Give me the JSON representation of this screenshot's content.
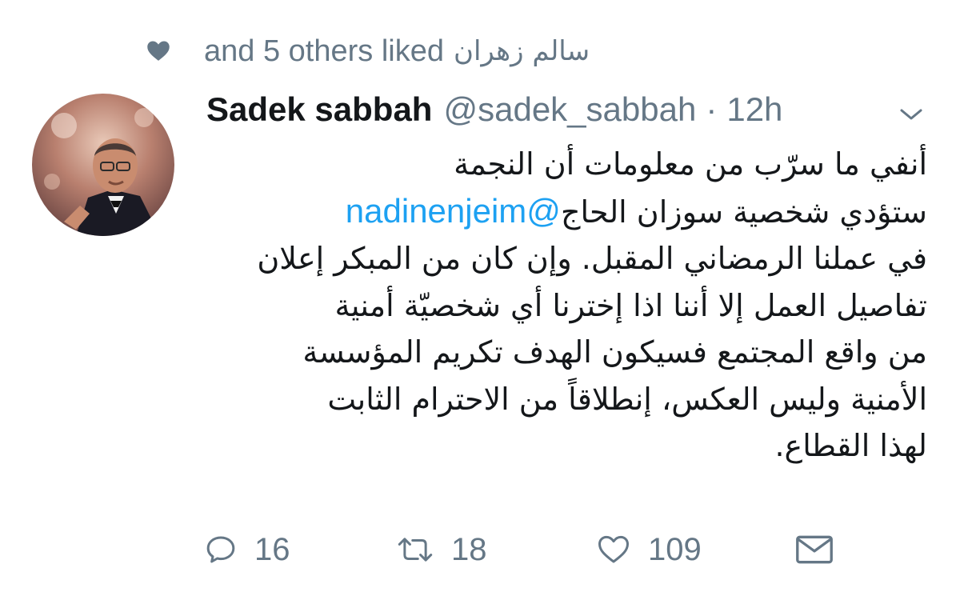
{
  "social_context": {
    "liked_text": "and 5 others liked",
    "liker_name": "سالم زهران"
  },
  "tweet": {
    "display_name": "Sadek sabbah",
    "handle": "@sadek_sabbah",
    "separator": "·",
    "time": "12h",
    "text": {
      "line1": "أنفي ما سرّب من معلومات أن النجمة",
      "mention": "@nadinenjeim",
      "line2_rest": " ستؤدي شخصية سوزان الحاج",
      "line3": "في عملنا الرمضاني المقبل. وإن كان من المبكر إعلان",
      "line4": "تفاصيل العمل إلا أننا اذا إخترنا أي شخصيّة أمنية",
      "line5": "من واقع المجتمع فسيكون الهدف تكريم المؤسسة",
      "line6": "الأمنية وليس العكس، إنطلاقاً من الاحترام الثابت",
      "line7": "لهذا القطاع."
    }
  },
  "actions": {
    "replies": "16",
    "retweets": "18",
    "likes": "109"
  },
  "icons": {
    "social_heart": "heart-icon",
    "caret": "chevron-down-icon",
    "reply": "reply-icon",
    "retweet": "retweet-icon",
    "like": "heart-outline-icon",
    "message": "envelope-icon"
  },
  "colors": {
    "text": "#14171a",
    "secondary": "#657786",
    "link": "#1da1f2",
    "background": "#ffffff"
  }
}
